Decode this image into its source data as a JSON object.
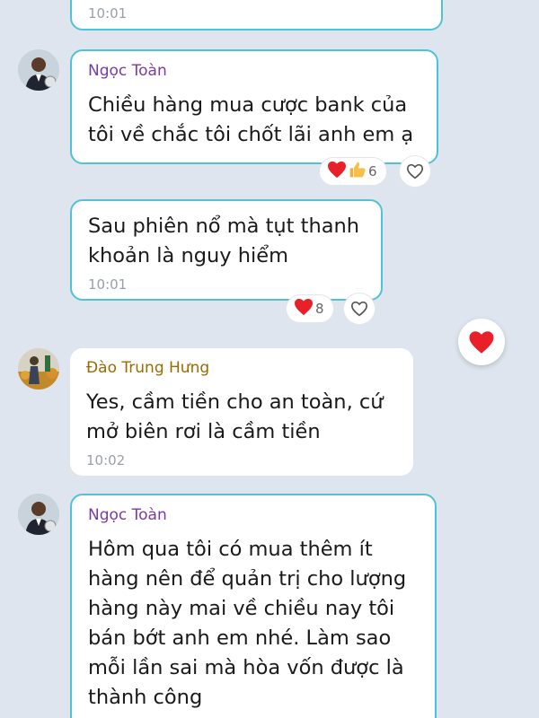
{
  "messages": [
    {
      "time": "10:01"
    },
    {
      "sender": "Ngọc Toàn",
      "text_lines": [
        "Chiều hàng mua cược bank của",
        "tôi về chắc tôi chốt lãi anh em ạ"
      ],
      "reactions": {
        "icons": [
          "heart-icon",
          "thumbs-up-icon"
        ],
        "count": "6"
      }
    },
    {
      "text_lines": [
        "Sau phiên nổ mà tụt thanh",
        "khoản là nguy hiểm"
      ],
      "time": "10:01",
      "reactions": {
        "icons": [
          "heart-icon"
        ],
        "count": "8"
      }
    },
    {
      "sender": "Đào Trung Hưng",
      "text_lines": [
        "Yes, cầm tiền cho an toàn, cứ",
        "mở biên rơi là cầm tiền"
      ],
      "time": "10:02"
    },
    {
      "sender": "Ngọc Toàn",
      "text_lines": [
        "Hôm qua tôi có mua thêm ít",
        "hàng nên để quản trị cho lượng",
        "hàng này mai về chiều nay tôi",
        "bán bớt anh em nhé. Làm sao",
        "mỗi lần sai mà hòa vốn được là",
        "thành công"
      ]
    }
  ],
  "colors": {
    "background": "#dfe5ee",
    "bubble_border": "#4fc3d6",
    "sender_purple": "#7a3aa6",
    "sender_gold": "#9a6b00",
    "heart_red": "#e8202a"
  }
}
